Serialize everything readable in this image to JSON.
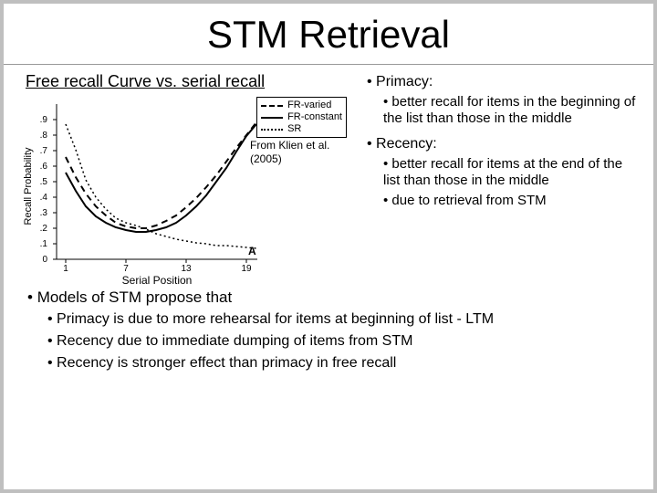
{
  "title": "STM Retrieval",
  "left": {
    "heading": "Free recall Curve vs. serial recall",
    "source": "From Klien et al. (2005)"
  },
  "right": {
    "primacy": {
      "label": "Primacy:",
      "items": [
        "better recall for items in the beginning of the list than those in the middle"
      ]
    },
    "recency": {
      "label": "Recency:",
      "items": [
        "better recall for items at the end of the list than those in the middle",
        "due to retrieval from STM"
      ]
    }
  },
  "lower": {
    "heading": "Models of STM propose that",
    "items": [
      "Primacy is due to more rehearsal for items at beginning of list - LTM",
      "Recency due to immediate dumping of items from STM",
      "Recency is stronger effect than primacy in free recall"
    ]
  },
  "chart_data": {
    "type": "line",
    "xlabel": "Serial Position",
    "ylabel": "Recall Probability",
    "panel": "A",
    "xlim": [
      1,
      20
    ],
    "ylim": [
      0,
      0.9
    ],
    "x": [
      1,
      2,
      3,
      4,
      5,
      6,
      7,
      8,
      9,
      10,
      11,
      12,
      13,
      14,
      15,
      16,
      17,
      18,
      19,
      20
    ],
    "series": [
      {
        "name": "FR-varied",
        "style": "dashed",
        "values": [
          0.66,
          0.53,
          0.42,
          0.34,
          0.28,
          0.24,
          0.21,
          0.2,
          0.2,
          0.22,
          0.25,
          0.28,
          0.34,
          0.4,
          0.47,
          0.54,
          0.63,
          0.72,
          0.8,
          0.88
        ]
      },
      {
        "name": "FR-constant",
        "style": "solid",
        "values": [
          0.56,
          0.44,
          0.34,
          0.28,
          0.24,
          0.21,
          0.19,
          0.18,
          0.18,
          0.19,
          0.21,
          0.24,
          0.28,
          0.34,
          0.41,
          0.5,
          0.59,
          0.69,
          0.79,
          0.87
        ]
      },
      {
        "name": "SR",
        "style": "dotted",
        "values": [
          0.87,
          0.71,
          0.51,
          0.4,
          0.32,
          0.27,
          0.24,
          0.22,
          0.19,
          0.17,
          0.15,
          0.13,
          0.12,
          0.11,
          0.1,
          0.09,
          0.09,
          0.08,
          0.08,
          0.07
        ]
      }
    ]
  }
}
